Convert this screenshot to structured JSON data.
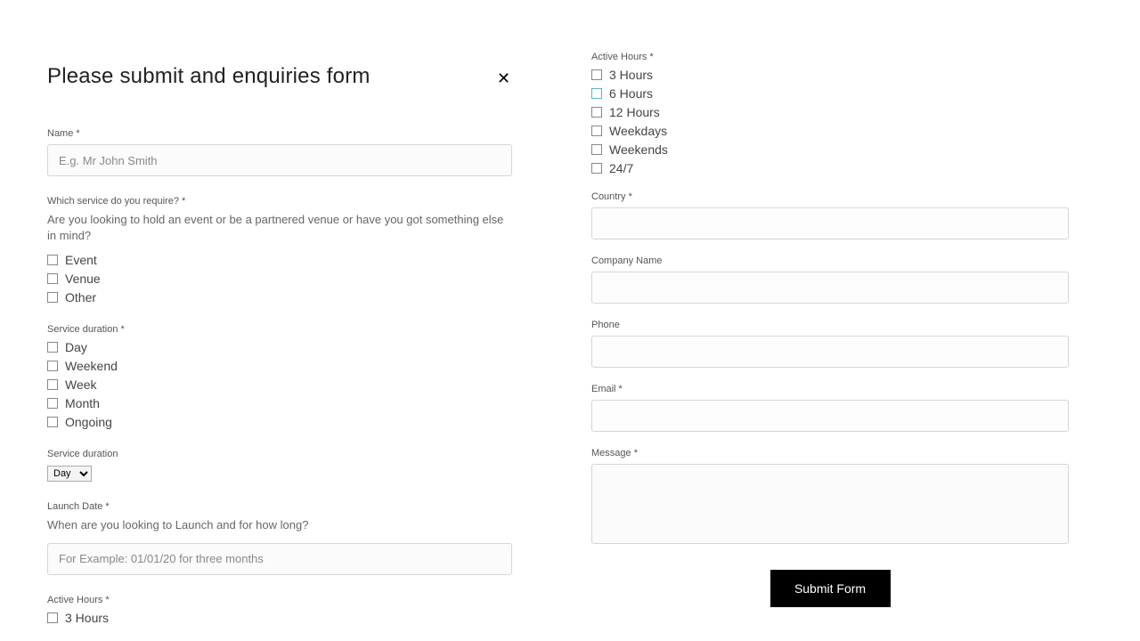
{
  "title": "Please submit and enquiries form",
  "close_symbol": "✕",
  "fields": {
    "name": {
      "label": "Name *",
      "placeholder": "E.g. Mr John Smith",
      "value": ""
    },
    "service": {
      "label": "Which service do you require? *",
      "desc": "Are you looking to hold an event or be a partnered venue or have you got something else in mind?",
      "options": [
        "Event",
        "Venue",
        "Other"
      ]
    },
    "duration_cb": {
      "label": "Service duration *",
      "options": [
        "Day",
        "Weekend",
        "Week",
        "Month",
        "Ongoing"
      ]
    },
    "duration_select": {
      "label": "Service duration",
      "selected": "Day"
    },
    "launch": {
      "label": "Launch Date *",
      "desc": "When are you looking to Launch and for how long?",
      "placeholder": "For Example: 01/01/20 for three months",
      "value": ""
    },
    "active_hours_left": {
      "label": "Active Hours *",
      "options": [
        "3 Hours"
      ]
    },
    "active_hours_right": {
      "label": "Active Hours *",
      "options": [
        "3 Hours",
        "6 Hours",
        "12 Hours",
        "Weekdays",
        "Weekends",
        "24/7"
      ],
      "hover_index": 1
    },
    "country": {
      "label": "Country *",
      "value": ""
    },
    "company": {
      "label": "Company Name",
      "value": ""
    },
    "phone": {
      "label": "Phone",
      "value": ""
    },
    "email": {
      "label": "Email *",
      "value": ""
    },
    "message": {
      "label": "Message *",
      "value": ""
    }
  },
  "submit_label": "Submit Form"
}
